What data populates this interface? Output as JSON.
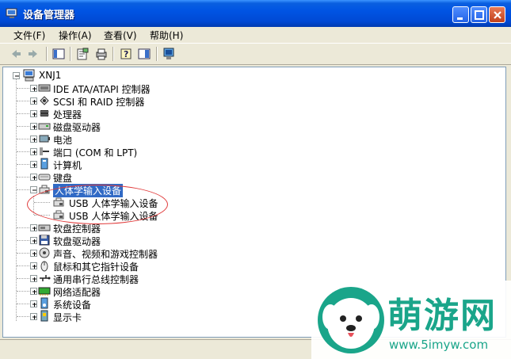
{
  "window": {
    "title": "设备管理器"
  },
  "menu": [
    "文件(F)",
    "操作(A)",
    "查看(V)",
    "帮助(H)"
  ],
  "tree": {
    "root": "XNJ1",
    "items": [
      {
        "label": "IDE ATA/ATAPI 控制器",
        "icon": "ide-controller-icon",
        "state": "collapsed"
      },
      {
        "label": "SCSI 和 RAID 控制器",
        "icon": "scsi-controller-icon",
        "state": "collapsed"
      },
      {
        "label": "处理器",
        "icon": "processor-icon",
        "state": "collapsed"
      },
      {
        "label": "磁盘驱动器",
        "icon": "disk-drive-icon",
        "state": "collapsed"
      },
      {
        "label": "电池",
        "icon": "battery-icon",
        "state": "collapsed"
      },
      {
        "label": "端口 (COM 和 LPT)",
        "icon": "port-icon",
        "state": "collapsed"
      },
      {
        "label": "计算机",
        "icon": "computer-icon",
        "state": "collapsed"
      },
      {
        "label": "键盘",
        "icon": "keyboard-icon",
        "state": "collapsed"
      },
      {
        "label": "人体学输入设备",
        "icon": "hid-icon",
        "state": "expanded",
        "selected": true,
        "children": [
          "USB 人体学输入设备",
          "USB 人体学输入设备"
        ]
      },
      {
        "label": "软盘控制器",
        "icon": "floppy-controller-icon",
        "state": "collapsed"
      },
      {
        "label": "软盘驱动器",
        "icon": "floppy-drive-icon",
        "state": "collapsed"
      },
      {
        "label": "声音、视频和游戏控制器",
        "icon": "sound-icon",
        "state": "collapsed"
      },
      {
        "label": "鼠标和其它指针设备",
        "icon": "mouse-icon",
        "state": "collapsed"
      },
      {
        "label": "通用串行总线控制器",
        "icon": "usb-icon",
        "state": "collapsed"
      },
      {
        "label": "网络适配器",
        "icon": "network-adapter-icon",
        "state": "collapsed"
      },
      {
        "label": "系统设备",
        "icon": "system-device-icon",
        "state": "collapsed"
      },
      {
        "label": "显示卡",
        "icon": "display-adapter-icon",
        "state": "collapsed"
      }
    ]
  },
  "watermark": {
    "text": "萌游网",
    "url": "www.5imyw.com"
  },
  "colors": {
    "selection": "#316ac5",
    "annotation": "#e03a3a",
    "watermark": "#1aa58a"
  }
}
